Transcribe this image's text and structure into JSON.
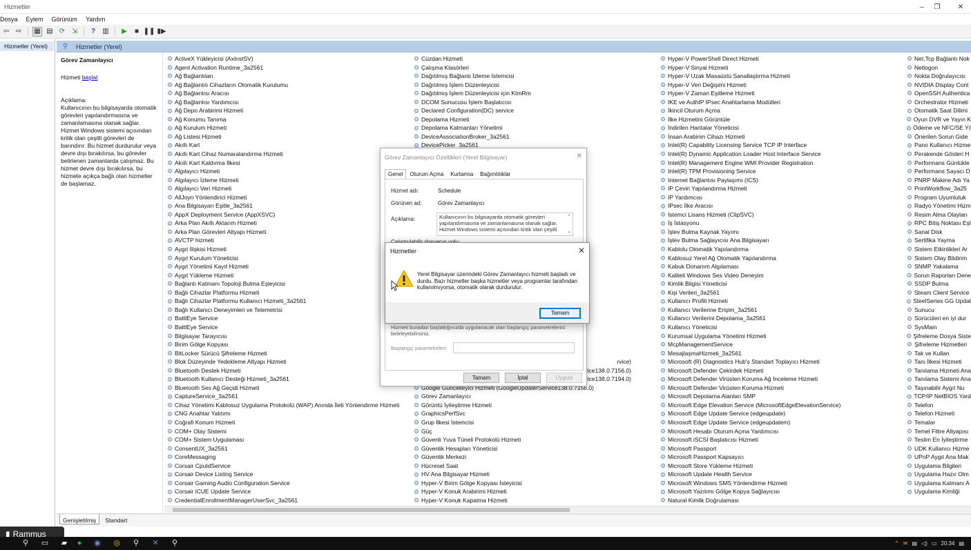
{
  "window": {
    "title": "Hizmetler",
    "minimize_glyph": "–",
    "maximize_glyph": "❐",
    "close_glyph": "✕"
  },
  "menu": [
    "Dosya",
    "Eylem",
    "Görünüm",
    "Yardım"
  ],
  "tree": {
    "root_label": "Hizmetler (Yerel)"
  },
  "header": {
    "title": "Hizmetler (Yerel)"
  },
  "description": {
    "service_name": "Görev Zamanlayıcı",
    "action_prefix": "Hizmeti ",
    "action_link": "başlat",
    "label": "Açıklama:",
    "text": "Kullanıcının bu bilgisayarda otomatik görevleri yapılandırmasına ve zamanlamasına olanak sağlar. Hizmet Windows sistemi açısından kritik olan çeşitli görevleri de barındırır. Bu hizmet durdurulur veya devre dışı bırakılırsa, bu görevler belirlenen zamanlarda çalışmaz. Bu hizmet devre dışı bırakılırsa, bu hizmete açıkça bağlı olan hizmetler de başlamaz."
  },
  "services": {
    "col1": [
      "ActiveX Yükleyicisi (AxInstSV)",
      "Agent Activation Runtime_3a2561",
      "Ağ Bağlantıları",
      "Ağ Bağlantılı Cihazların Otomatik Kurulumu",
      "Ağ Bağlantısı Aracısı",
      "Ağ Bağlantısı Yardımcısı",
      "Ağ Depo Arabirimi Hizmeti",
      "Ağ Konumu Tanıma",
      "Ağ Kurulum Hizmeti",
      "Ağ Listesi Hizmeti",
      "Akıllı Kart",
      "Akıllı Kart Cihaz Numaralandırma Hizmeti",
      "Akıllı Kart Kaldırma İlkesi",
      "Algılayıcı Hizmeti",
      "Algılayıcı İzleme Hizmeti",
      "Algılayıcı Veri Hizmeti",
      "AllJoyn Yönlendirici Hizmeti",
      "Ana Bilgisayarı Eşitle_3a2561",
      "AppX Deployment Service (AppXSVC)",
      "Arka Plan Akıllı Aktarım Hizmeti",
      "Arka Plan Görevleri Altyapı Hizmeti",
      "AVCTP hizmeti",
      "Aygıt İlişkisi Hizmeti",
      "Aygıt Kurulum Yöneticisi",
      "Aygıt Yönetimi Kayıt Hizmeti",
      "Aygıt Yükleme Hizmeti",
      "Bağlantı Katmanı Topoloji Bulma Eşleyicisi",
      "Bağlı Cihazlar Platformu Hizmeti",
      "Bağlı Cihazlar Platformu Kullanıcı Hizmeti_3a2561",
      "Bağlı Kullanıcı Deneyimleri ve Telemetrisi",
      "BattlEye Service",
      "BattlEye Service",
      "Bilgisayar Tarayıcısı",
      "Birim Gölge Kopyası",
      "BitLocker Sürücü Şifreleme Hizmeti",
      "Blok Düzeyinde Yedekleme Altyapı Hizmeti",
      "Bluetooth Destek Hizmeti",
      "Bluetooth Kullanıcı Desteği Hizmeti_3a2561",
      "Bluetooth Ses Ağ Geçidi Hizmeti",
      "CaptureService_3a2561",
      "Cihaz Yönetimi Kablosuz Uygulama Protokolü (WAP) Anında İleti Yönlendirme Hizmeti",
      "CNG Anahtar Yalıtımı",
      "Coğrafi Konum Hizmeti",
      "COM+ Olay Sistemi",
      "COM+ Sistem Uygulaması",
      "ConsentUX_3a2561",
      "CoreMessaging",
      "Corsair CpuIdService",
      "Corsair Device Listing Service",
      "Corsair Gaming Audio Configuration Service",
      "Corsair iCUE Update Service",
      "CredentialEnrollmentManagerUserSvc_3a2561"
    ],
    "col2": [
      "Cüzdan Hizmeti",
      "Çalışma Klasörleri",
      "Dağıtılmış Bağlantı İzleme İstemcisi",
      "Dağıtılmış İşlem Düzenleyicisi",
      "Dağıtılmış İşlem Düzenleyicisi için KtmRm",
      "DCOM Sunucusu İşlem Başlatıcısı",
      "Declared Configuration(DC) service",
      "Depolama Hizmeti",
      "Depolama Katmanları Yönetimi",
      "DeviceAssociationBroker_3a2561",
      "DevicePicker_3a2561",
      "",
      "",
      "",
      "",
      "",
      "",
      "",
      "",
      "",
      "",
      "",
      "",
      "",
      "",
      "",
      "",
      "",
      "",
      "",
      "",
      "",
      "",
      "",
      "",
      "",
      "",
      "",
      "",
      "Görev Zamanlayıcı",
      "Görüntü İyileştirme Hizmeti",
      "GraphicsPerfSvc",
      "Grup İlkesi İstemcisi",
      "Güç",
      "Güvenli Yuva Tüneli Protokolü Hizmeti",
      "Güvenlik Hesapları Yöneticisi",
      "Güvenlik Merkezi",
      "Hücresel Saat",
      "HV Ana Bilgisayar Hizmeti",
      "Hyper-V Birim Gölge Kopyası İsteyicisi",
      "Hyper-V Konuk Arabirimi Hizmeti",
      "Hyper-V Konuk Kapatma Hizmeti"
    ],
    "col2_partial": [
      {
        "row": 35,
        "text": "rvice)"
      },
      {
        "row": 36,
        "text": "rvice138.0.7156.0)"
      },
      {
        "row": 37,
        "text": "rvice138.0.7194.0)"
      },
      {
        "row": 38,
        "text": "Google Güncelleyici Hizmeti (GoogleUpdaterService138.0.7156.0)"
      }
    ],
    "col3": [
      "Hyper-V PowerShell Direct Hizmeti",
      "Hyper-V Sinyal Hizmeti",
      "Hyper-V Uzak Masaüstü Sanallaştırma Hizmeti",
      "Hyper-V Veri Değişimi Hizmeti",
      "Hyper-V Zaman Eşitleme Hizmeti",
      "IKE ve AuthIP IPsec Anahtarlama Modülleri",
      "İkincil Oturum Açma",
      "İlke Hizmetini Görüntüle",
      "İndirilen Haritalar Yöneticisi",
      "İnsan Arabirim Cihazı Hizmeti",
      "Intel(R) Capability Licensing Service TCP IP Interface",
      "Intel(R) Dynamic Application Loader Host Interface Service",
      "Intel(R) Management Engine WMI Provider Registration",
      "Intel(R) TPM Provisioning Service",
      "Internet Bağlantısı Paylaşımı (ICS)",
      "IP Çeviri Yapılandırma Hizmeti",
      "IP Yardımcısı",
      "IPsec İlke Aracısı",
      "İstemci Lisans Hizmeti (ClipSVC)",
      "İş İstasyonu",
      "İşlev Bulma Kaynak Yayımı",
      "İşlev Bulma Sağlayıcısı Ana Bilgisayarı",
      "Kablolu Otomatik Yapılandırma",
      "Kablosuz Yerel Ağ Otomatik Yapılandırma",
      "Kabuk Donanım Algılaması",
      "Kaliteli Windows Ses Video Deneyim",
      "Kimlik Bilgisi Yöneticisi",
      "Kişi Verileri_3a2561",
      "Kullanıcı Profili Hizmeti",
      "Kullanıcı Verilerine Erişim_3a2561",
      "Kullanıcı Verilerini Depolama_3a2561",
      "Kullanıcı Yöneticisi",
      "Kurumsal Uygulama Yönetimi Hizmeti",
      "McpManagementService",
      "MesajlaşmaHizmeti_3a2561",
      "Microsoft (R) Diagnostics Hub's Standart Toplayıcı Hizmeti",
      "Microsoft Defender Çekirdek Hizmeti",
      "Microsoft Defender Virüsten Koruma Ağ İnceleme Hizmeti",
      "Microsoft Defender Virüsten Koruma Hizmeti",
      "Microsoft Depolama Alanları SMP",
      "Microsoft Edge Elevation Service (MicrosoftEdgeElevationService)",
      "Microsoft Edge Update Service (edgeupdate)",
      "Microsoft Edge Update Service (edgeupdatem)",
      "Microsoft Hesabı Oturum Açma Yardımcısı",
      "Microsoft iSCSI Başlatıcısı Hizmeti",
      "Microsoft Passport",
      "Microsoft Passport Kapsayıcı",
      "Microsoft Store Yükleme Hizmeti",
      "Microsoft Update Health Service",
      "Microsoft Windows SMS Yönlendirme Hizmeti",
      "Microsoft Yazılımı Gölge Kopya Sağlayıcısı",
      "Natural Kimlik Doğrulaması"
    ],
    "col4": [
      "Net.Tcp Bağlantı Nok",
      "Netlogon",
      "Nokta Doğrulayıcısı",
      "NVIDIA Display Cont",
      "OpenSSH Authentica",
      "Orchestrator Hizmeti",
      "Otomatik Saat Dilimi",
      "Oyun DVR ve Yayın K",
      "Ödeme ve NFC/SE Yö",
      "Önerilen Sorun Gide",
      "Pano Kullanıcı Hizme",
      "Perakende Gösteri H",
      "Performans Günlükle",
      "Performans Sayacı D",
      "PNRP Makine Adı Ya",
      "PrintWorkflow_3a25",
      "Program Uyumluluk",
      "Radyo Yönetimi Hizm",
      "Resim Alma Olayları",
      "RPC Bitiş Noktası Eşl",
      "Sanal Disk",
      "Sertifika Yayma",
      "Sistem Etkinlikleri Ar",
      "Sistem Olay Bildirim",
      "SNMP Yakalama",
      "Sorun Raporları Dene",
      "SSDP Bulma",
      "Steam Client Service",
      "SteelSeries GG Updat",
      "Sunucu",
      "Sürücüleri en iyi dur",
      "SysMain",
      "Şifreleme Dosya Siste",
      "Şifreleme Hizmetleri",
      "Tak ve Kullan",
      "Tanı İlkesi Hizmeti",
      "Tanılama Hizmeti Ana",
      "Tanılama Sistemi Ana",
      "Taşınabilir Aygıt Nu",
      "TCP/IP NetBIOS Yard",
      "Telefon",
      "Telefon Hizmeti",
      "Temalar",
      "Temel Filtre Altyapısı",
      "Teslim En İyileştirme",
      "UDK Kullanıcı Hizme",
      "UPnP Aygıt Ana Mak",
      "Uygulama Bilgileri",
      "Uygulama Hazır Olm",
      "Uygulama Katmanı A",
      "Uygulama Kimliği"
    ]
  },
  "tabs": [
    "Genişletilmiş",
    "Standart"
  ],
  "properties": {
    "title": "Görev Zamanlayıcı Özellikleri (Yerel Bilgisayar)",
    "tabs": [
      "Genel",
      "Oturum Açma",
      "Kurtarma",
      "Bağımlılıklar"
    ],
    "service_name_label": "Hizmet adı:",
    "service_name_value": "Schedule",
    "display_name_label": "Görünen ad:",
    "display_name_value": "Görev Zamanlayıcı",
    "description_label": "Açıklama:",
    "description_value": "Kullanıcının bu bilgisayarda otomatik görevleri yapılandırmasına ve zamanlamasına olanak sağlar. Hizmet Windows sistemi açısından kritik olan çeşitli",
    "exec_label": "Çalıştırılabilir dosyanın yolu:",
    "params_help": "Hizmeti buradan başlattığınızda uygulanacak olan başlangıç parametrelerini belirleyebilirsiniz.",
    "params_label": "Başlangıç parametreleri:",
    "ok": "Tamam",
    "cancel": "İptal",
    "apply": "Uygula"
  },
  "message": {
    "title": "Hizmetler",
    "text": "Yerel Bilgisayar üzerindeki Görev Zamanlayıcı hizmeti başladı ve durdu. Bazı hizmetler başka hizmetler veya programlar tarafından kullanılmıyorsa, otomatik olarak durdurulur.",
    "ok": "Tamam"
  },
  "overlay": {
    "label": "Rammus"
  },
  "tray": {
    "time": "20:34"
  }
}
